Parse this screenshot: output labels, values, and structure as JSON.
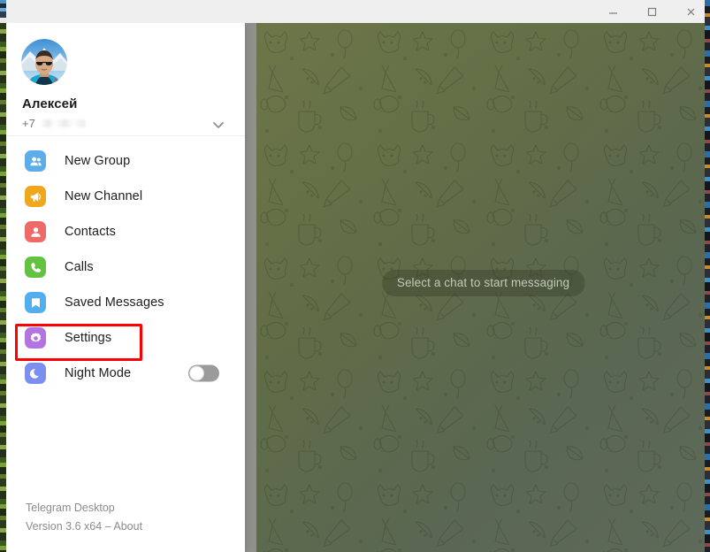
{
  "window": {
    "controls": [
      {
        "name": "minimize",
        "glyph": "minimize-icon"
      },
      {
        "name": "maximize",
        "glyph": "maximize-icon"
      },
      {
        "name": "close",
        "glyph": "close-icon"
      }
    ]
  },
  "profile": {
    "name": "Алексей",
    "phone_prefix": "+7",
    "phone_hidden": true,
    "expand_icon": "chevron-down-icon"
  },
  "menu": {
    "items": [
      {
        "label": "New Group",
        "icon": "new-group-icon",
        "color": "#5DADE8"
      },
      {
        "label": "New Channel",
        "icon": "new-channel-icon",
        "color": "#EFA81E"
      },
      {
        "label": "Contacts",
        "icon": "contacts-icon",
        "color": "#EE6A66"
      },
      {
        "label": "Calls",
        "icon": "calls-icon",
        "color": "#63C341"
      },
      {
        "label": "Saved Messages",
        "icon": "saved-messages-icon",
        "color": "#52AEEC"
      },
      {
        "label": "Settings",
        "icon": "settings-gear-icon",
        "color": "#B374E2"
      },
      {
        "label": "Night Mode",
        "icon": "night-mode-icon",
        "color": "#7C8FF0"
      }
    ],
    "night_mode_enabled": false,
    "highlighted_item": "Settings",
    "highlight_color": "#ff0000"
  },
  "footer": {
    "app_name": "Telegram Desktop",
    "version_line": "Version 3.6 x64 – About"
  },
  "chat": {
    "empty_state": "Select a chat to start messaging"
  }
}
